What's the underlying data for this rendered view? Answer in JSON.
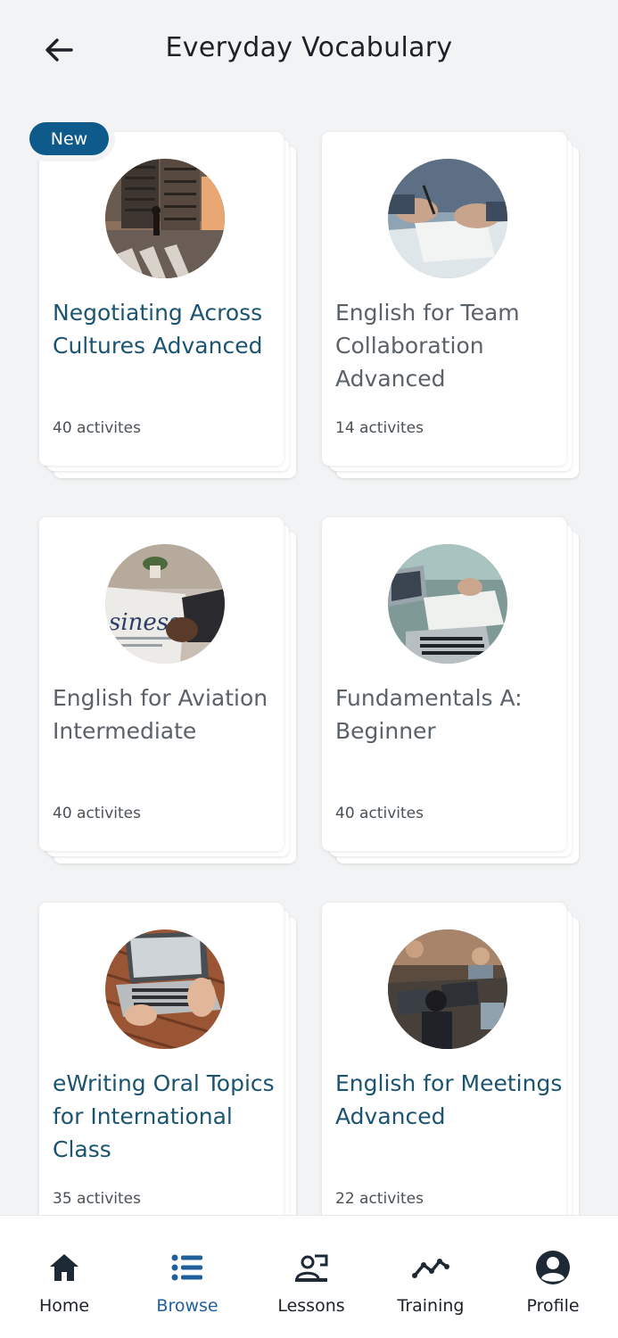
{
  "header": {
    "title": "Everyday Vocabulary"
  },
  "badge": {
    "label": "New"
  },
  "courses": [
    {
      "title": "Negotiating Across Cultures Advanced",
      "count": "40 activites",
      "image": "city-street-photo"
    },
    {
      "title": "English for Team Collaboration Advanced",
      "count": "14 activites",
      "image": "signing-document-photo"
    },
    {
      "title": "English for Aviation Intermediate",
      "count": "40 activites",
      "image": "business-newspaper-photo"
    },
    {
      "title": "Fundamentals A: Beginner",
      "count": "40 activites",
      "image": "laptops-meeting-photo"
    },
    {
      "title": "eWriting Oral Topics for International Class",
      "count": "35 activites",
      "image": "laptop-typing-photo"
    },
    {
      "title": "English for Meetings Advanced",
      "count": "22 activites",
      "image": "office-team-photo"
    }
  ],
  "tabbar": {
    "items": [
      {
        "label": "Home",
        "icon": "home-icon"
      },
      {
        "label": "Browse",
        "icon": "list-icon",
        "active": true
      },
      {
        "label": "Lessons",
        "icon": "lessons-icon"
      },
      {
        "label": "Training",
        "icon": "trend-icon"
      },
      {
        "label": "Profile",
        "icon": "profile-icon"
      }
    ]
  },
  "colors": {
    "accent": "#1b5470",
    "badge": "#0e5a8a",
    "active_tab": "#1f5f9c",
    "background": "#f2f3f4"
  }
}
